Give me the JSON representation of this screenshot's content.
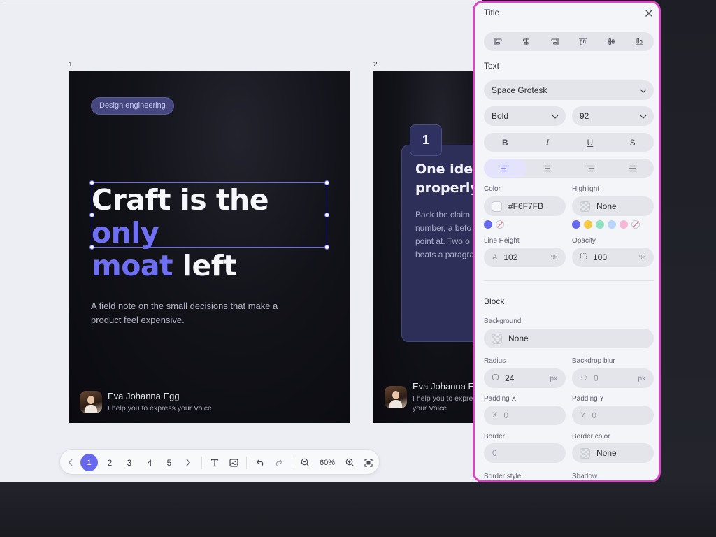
{
  "canvas": {
    "slides": [
      {
        "number": "1",
        "chip": "Design engineering",
        "headline": {
          "part1": "Craft is the ",
          "part2": "only",
          "part3": "moat",
          "part4": " left"
        },
        "subtitle": "A field note on the small decisions that make a product feel expensive.",
        "author_name": "Eva Johanna Egg",
        "author_role": "I help you to express your Voice"
      },
      {
        "number": "2",
        "badge": "1",
        "title": "One idea\nproperly",
        "body": "Back the claim\nnumber, a befo\npoint at. Two o\nbeats a paragra",
        "author_name": "Eva Johanna Egg",
        "author_role": "I help you to express your Voice"
      }
    ]
  },
  "toolbar": {
    "pages": [
      "1",
      "2",
      "3",
      "4",
      "5"
    ],
    "active_page": "1",
    "zoom": "60%",
    "icons": [
      "chevron-left-icon",
      "chevron-right-icon",
      "text-icon",
      "image-icon",
      "undo-icon",
      "redo-icon",
      "zoom-out-icon",
      "zoom-in-icon",
      "fit-screen-icon"
    ]
  },
  "panel": {
    "title": "Title",
    "text_section": "Text",
    "font_family": "Space Grotesk",
    "font_weight": "Bold",
    "font_size": "92",
    "style_buttons": [
      "B",
      "I",
      "U",
      "S"
    ],
    "color_label": "Color",
    "color_value": "#F6F7FB",
    "color_swatch": "#F6F7FB",
    "highlight_label": "Highlight",
    "highlight_value": "None",
    "color_presets": [
      "#6768EE"
    ],
    "highlight_presets": [
      "#6768EE",
      "#F5C842",
      "#8EE0C0",
      "#B8D4F8",
      "#F7B8D8"
    ],
    "line_height_label": "Line Height",
    "line_height_lead": "A",
    "line_height_value": "102",
    "line_height_unit": "%",
    "opacity_label": "Opacity",
    "opacity_value": "100",
    "opacity_unit": "%",
    "block_section": "Block",
    "background_label": "Background",
    "background_value": "None",
    "radius_label": "Radius",
    "radius_value": "24",
    "radius_unit": "px",
    "backdrop_label": "Backdrop blur",
    "backdrop_value": "0",
    "backdrop_unit": "px",
    "padding_x_label": "Padding X",
    "padding_x_lead": "X",
    "padding_x_value": "0",
    "padding_y_label": "Padding Y",
    "padding_y_lead": "Y",
    "padding_y_value": "0",
    "border_label": "Border",
    "border_value": "0",
    "border_color_label": "Border color",
    "border_color_value": "None",
    "border_style_label": "Border style",
    "shadow_label": "Shadow",
    "accent_color": "#6768EE",
    "highlight_frame_color": "#D946C4"
  }
}
